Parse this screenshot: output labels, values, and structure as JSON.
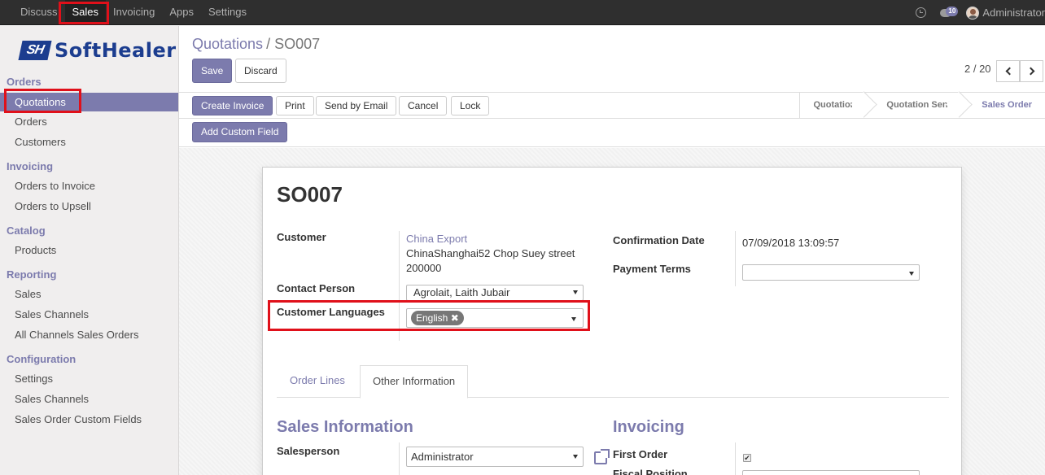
{
  "topbar": {
    "menu": [
      "Discuss",
      "Sales",
      "Invoicing",
      "Apps",
      "Settings"
    ],
    "active_menu": "Sales",
    "chat_count": "10",
    "user_name": "Administrator"
  },
  "sidebar": {
    "logo_mark": "SH",
    "logo_text": "SoftHealer",
    "sections": [
      {
        "title": "Orders",
        "items": [
          "Quotations",
          "Orders",
          "Customers"
        ]
      },
      {
        "title": "Invoicing",
        "items": [
          "Orders to Invoice",
          "Orders to Upsell"
        ]
      },
      {
        "title": "Catalog",
        "items": [
          "Products"
        ]
      },
      {
        "title": "Reporting",
        "items": [
          "Sales",
          "Sales Channels",
          "All Channels Sales Orders"
        ]
      },
      {
        "title": "Configuration",
        "items": [
          "Settings",
          "Sales Channels",
          "Sales Order Custom Fields"
        ]
      }
    ],
    "active_item": "Quotations"
  },
  "control_panel": {
    "breadcrumb_parent": "Quotations",
    "breadcrumb_sep": "/",
    "breadcrumb_current": "SO007",
    "save_label": "Save",
    "discard_label": "Discard",
    "pager": "2 / 20",
    "actions": [
      "Create Invoice",
      "Print",
      "Send by Email",
      "Cancel",
      "Lock"
    ],
    "stages": [
      "Quotation",
      "Quotation Sent",
      "Sales Order"
    ],
    "current_stage": "Sales Order",
    "add_custom_field_label": "Add Custom Field"
  },
  "form": {
    "title": "SO007",
    "customer_label": "Customer",
    "customer_name": "China Export",
    "customer_address_1": "ChinaShanghai52 Chop Suey street",
    "customer_address_2": "200000",
    "contact_person_label": "Contact Person",
    "contact_person_value": "Agrolait, Laith Jubair",
    "customer_languages_label": "Customer Languages",
    "language_tag": "English ✖",
    "confirmation_date_label": "Confirmation Date",
    "confirmation_date_value": "07/09/2018 13:09:57",
    "payment_terms_label": "Payment Terms",
    "payment_terms_value": "",
    "tabs": [
      "Order Lines",
      "Other Information"
    ],
    "active_tab": "Other Information",
    "sales_info_heading": "Sales Information",
    "salesperson_label": "Salesperson",
    "salesperson_value": "Administrator",
    "invoicing_heading": "Invoicing",
    "first_order_label": "First Order",
    "first_order_checked": true,
    "fiscal_position_label": "Fiscal Position"
  },
  "colors": {
    "accent": "#7c7bad",
    "highlight": "#e0101a",
    "navbar": "#2f2f2f"
  }
}
